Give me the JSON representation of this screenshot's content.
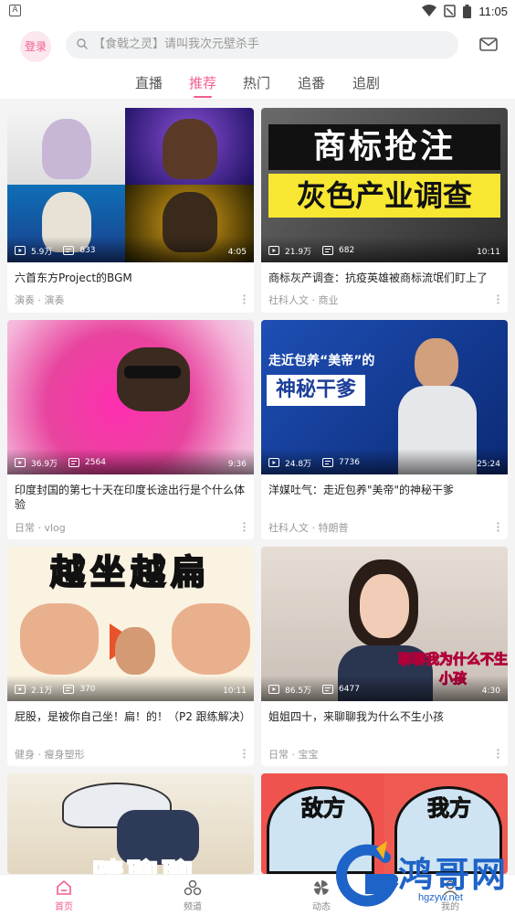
{
  "statusbar": {
    "notification_letter": "A",
    "time": "11:05"
  },
  "header": {
    "login_label": "登录",
    "search_placeholder": "【食戟之灵】请叫我次元壁杀手"
  },
  "tabs": [
    {
      "label": "直播"
    },
    {
      "label": "推荐",
      "active": true
    },
    {
      "label": "热门"
    },
    {
      "label": "追番"
    },
    {
      "label": "追剧"
    }
  ],
  "cards": [
    {
      "views": "5.9万",
      "danmaku": "833",
      "duration": "4:05",
      "title": "六首东方Project的BGM",
      "meta": "演奏 · 演奏"
    },
    {
      "views": "21.9万",
      "danmaku": "682",
      "duration": "10:11",
      "title": "商标灰产调查：抗疫英雄被商标流氓们盯上了",
      "meta": "社科人文 · 商业",
      "thumb_text": [
        "商标抢注",
        "灰色产业调查"
      ]
    },
    {
      "views": "36.9万",
      "danmaku": "2564",
      "duration": "9:36",
      "title": "印度封国的第七十天在印度长途出行是个什么体验",
      "meta": "日常 · vlog"
    },
    {
      "views": "24.8万",
      "danmaku": "7736",
      "duration": "25:24",
      "title": "洋媒吐气：走近包养\"美帝\"的神秘干爹",
      "meta": "社科人文 · 特朗普",
      "thumb_text": [
        "走近包养“美帝”的",
        "神秘干爹"
      ]
    },
    {
      "views": "2.1万",
      "danmaku": "370",
      "duration": "10:11",
      "title": "屁股，是被你自己坐！扁！的！（P2 跟练解决）",
      "meta": "健身 · 瘦身塑形",
      "thumb_text": [
        "越坐越扁"
      ]
    },
    {
      "views": "86.5万",
      "danmaku": "6477",
      "duration": "4:30",
      "title": "姐姐四十，来聊聊我为什么不生小孩",
      "meta": "日常 · 宝宝",
      "thumb_text": [
        "聊聊我为什么不生小孩"
      ]
    },
    {
      "thumb_text": [
        "晴聊聊"
      ]
    },
    {
      "thumb_text": [
        "敌方",
        "我方"
      ]
    }
  ],
  "bottom_nav": [
    {
      "label": "首页",
      "icon": "home-icon",
      "active": true
    },
    {
      "label": "频道",
      "icon": "channel-icon"
    },
    {
      "label": "动态",
      "icon": "dynamic-icon"
    },
    {
      "label": "我的",
      "icon": "profile-icon"
    }
  ],
  "watermark": {
    "brand": "鸿哥网",
    "url": "hgzyw.net"
  },
  "colors": {
    "accent": "#f25d8e",
    "background": "#f4f4f4",
    "meta_text": "#999999"
  }
}
